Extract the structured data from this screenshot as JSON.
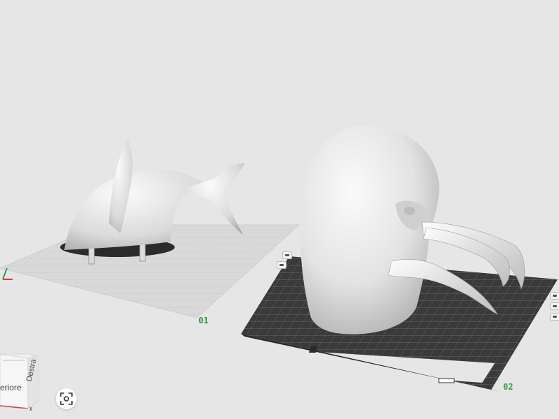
{
  "viewport": {
    "background_color": "#e6e6e6"
  },
  "plates": [
    {
      "label": "01",
      "label_color": "#2ea043",
      "surface": "light grid"
    },
    {
      "label": "02",
      "label_color": "#2ea043",
      "surface": "dark textured PEI sheet"
    }
  ],
  "plate_side_controls": [
    {
      "icon": "plate-settings-icon"
    },
    {
      "icon": "plate-settings-icon"
    }
  ],
  "models": [
    {
      "name": "whale-tail-model",
      "plate": "01"
    },
    {
      "name": "walrus-head-model",
      "plate": "02"
    }
  ],
  "view_cube": {
    "front_label": "eriore",
    "right_label": "Destra",
    "top_label": "~~~~~~~~~",
    "axis_x_label": "x"
  },
  "toolbar": {
    "recenter_icon": "recenter-view-icon"
  }
}
